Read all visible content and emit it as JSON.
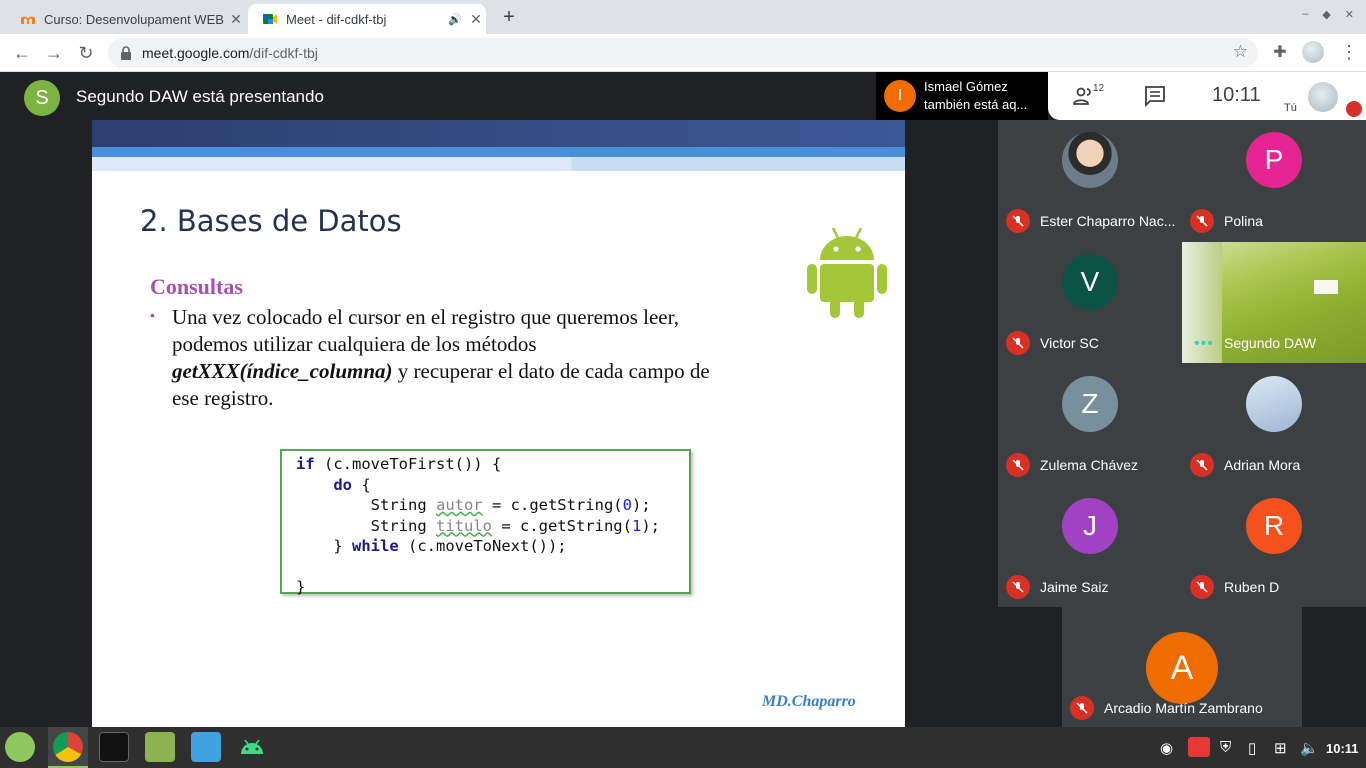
{
  "browser": {
    "tabs": [
      {
        "title": "Curso: Desenvolupament WEB",
        "active": false
      },
      {
        "title": "Meet - dif-cdkf-tbj",
        "active": true
      }
    ],
    "url_host": "meet.google.com",
    "url_path": "/dif-cdkf-tbj"
  },
  "meet": {
    "presenter_initial": "S",
    "presenting_text": "Segundo DAW está presentando",
    "notification": {
      "initial": "I",
      "text": "Ismael Gómez también está aq..."
    },
    "people_count": "12",
    "time": "10:11",
    "self_label": "Tú"
  },
  "slide": {
    "title": "2. Bases de Datos",
    "subtitle": "Consultas",
    "bullet": "•",
    "body_line1": "Una vez colocado el cursor en el registro que queremos leer,",
    "body_line2": "podemos utilizar cualquiera de los métodos",
    "body_method": "getXXX(índice_columna)",
    "body_line3_rest": " y recuperar el dato de cada campo de",
    "body_line4": "ese registro.",
    "code": {
      "kw_if": "if",
      "line1_rest": " (c.moveToFirst()) {",
      "kw_do": "do",
      "brace_open": " {",
      "string_type": "String ",
      "var_autor": "autor",
      "line3_mid": " = c.getString(",
      "num_0": "0",
      "line_end": ");",
      "var_titulo": "titulo",
      "num_1": "1",
      "brace_close": "} ",
      "kw_while": "while",
      "line5_rest": " (c.moveToNext());",
      "final_brace": "}"
    },
    "footer": "MD.Chaparro"
  },
  "participants": [
    {
      "name": "Ester Chaparro Nac...",
      "initial": "",
      "color": "#5b6b7a"
    },
    {
      "name": "Polina",
      "initial": "P",
      "color": "#e52592"
    },
    {
      "name": "Victor SC",
      "initial": "V",
      "color": "#0b5345"
    },
    {
      "name": "Segundo DAW",
      "initial": "",
      "color": ""
    },
    {
      "name": "Zulema Chávez",
      "initial": "Z",
      "color": "#78909c"
    },
    {
      "name": "Adrian Mora",
      "initial": "",
      "color": "#9fb8d6"
    },
    {
      "name": "Jaime Saiz",
      "initial": "J",
      "color": "#a142c4"
    },
    {
      "name": "Ruben D",
      "initial": "R",
      "color": "#f4511e"
    }
  ],
  "extra_participant": {
    "name": "Arcadio Martín Zambrano",
    "initial": "A"
  },
  "taskbar": {
    "clock": "10:11"
  },
  "colors": {
    "mic_off": "#d93025",
    "android_green": "#a4c639",
    "meet_dark": "#202124"
  }
}
